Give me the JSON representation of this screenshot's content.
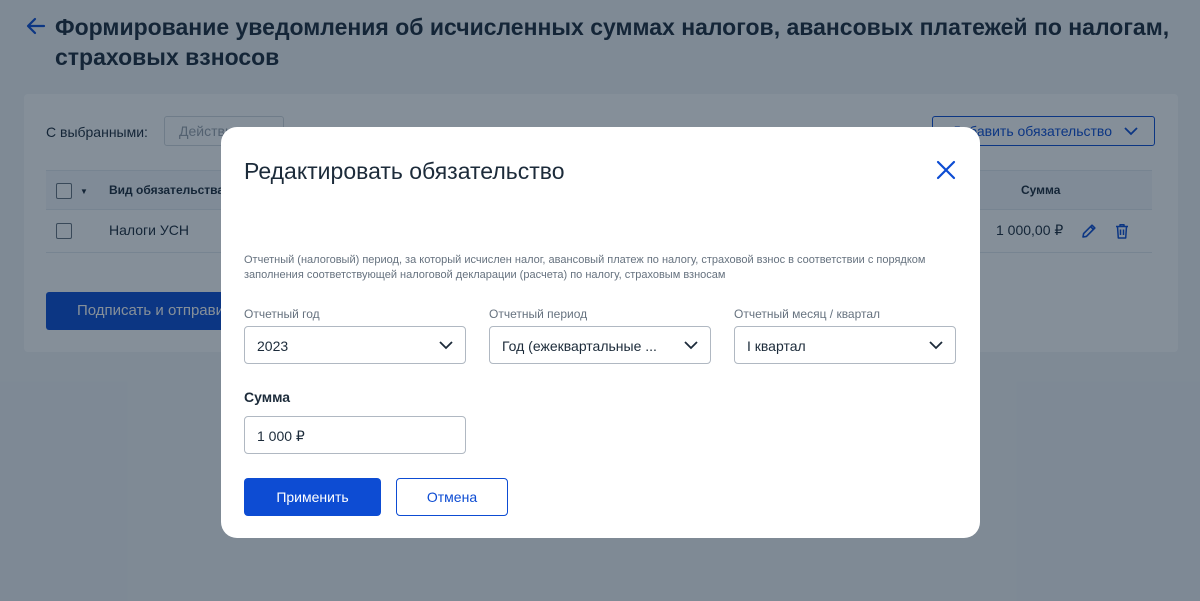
{
  "page": {
    "title": "Формирование уведомления об исчисленных суммах налогов, авансовых платежей по налогам, страховых взносов"
  },
  "toolbar": {
    "with_selected_label": "С выбранными:",
    "actions_value": "Действия",
    "add_obligation_label": "Добавить обязательство"
  },
  "table": {
    "columns": [
      "Вид обязательства",
      "Сумма"
    ],
    "rows": [
      {
        "type": "Налоги УСН",
        "sum": "1 000,00 ₽"
      }
    ]
  },
  "footer": {
    "sign_button_label": "Подписать и отправить"
  },
  "modal": {
    "title": "Редактировать обязательство",
    "description": "Отчетный (налоговый) период, за который исчислен налог, авансовый платеж по налогу, страховой взнос в соответствии с порядком заполнения соответствующей налоговой декларации (расчета) по налогу, страховым взносам",
    "year": {
      "label": "Отчетный год",
      "value": "2023"
    },
    "period": {
      "label": "Отчетный период",
      "value": "Год (ежеквартальные ..."
    },
    "month": {
      "label": "Отчетный месяц / квартал",
      "value": "I квартал"
    },
    "sum": {
      "label": "Сумма",
      "value": "1 000 ₽"
    },
    "apply_label": "Применить",
    "cancel_label": "Отмена"
  },
  "icons": {
    "back": "arrow-left-icon",
    "close": "close-icon",
    "chevron": "chevron-down-icon",
    "edit": "pencil-icon",
    "delete": "trash-icon"
  },
  "colors": {
    "accent": "#0d4cd3",
    "overlay": "#0b1f33",
    "text": "#1c2b3a",
    "muted": "#66727f"
  }
}
